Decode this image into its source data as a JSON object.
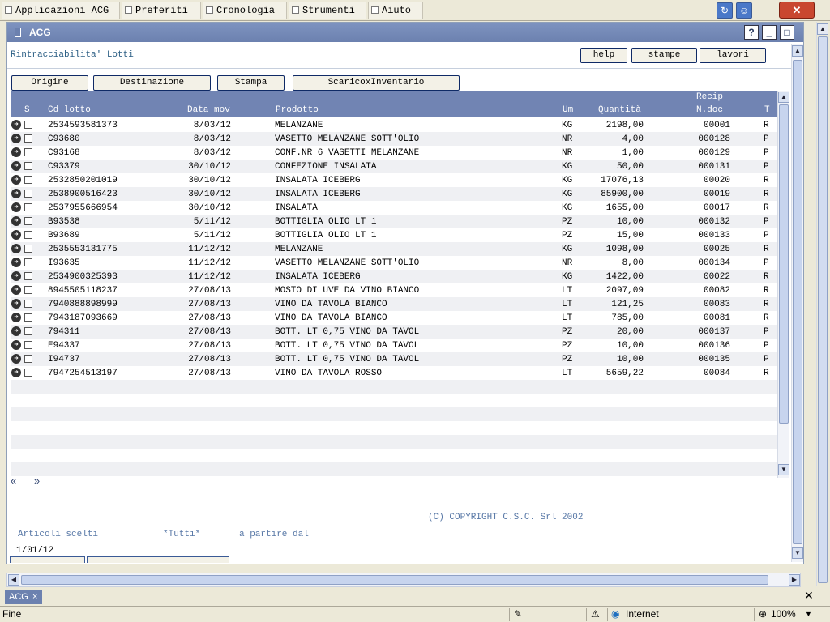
{
  "menubar": {
    "items": [
      "Applicazioni ACG",
      "Preferiti",
      "Cronologia",
      "Strumenti",
      "Aiuto"
    ],
    "close_icon": "close-icon"
  },
  "window": {
    "title": "ACG",
    "help_btn": "?",
    "min_btn": "_",
    "max_btn": "□"
  },
  "page": {
    "subtitle": "Rintracciabilita' Lotti",
    "top_buttons": [
      "help",
      "stampe",
      "lavori"
    ],
    "nav_buttons": [
      "Origine",
      "Destinazione",
      "Stampa",
      "ScaricoxInventario"
    ]
  },
  "table": {
    "headers": {
      "s": "S",
      "cd_lotto": "Cd lotto",
      "data_mov": "Data mov",
      "prodotto": "Prodotto",
      "um": "Um",
      "quantita": "Quantità",
      "recip": "Recip",
      "ndoc": "N.doc",
      "t": "T"
    },
    "rows": [
      [
        "2534593581373",
        "8/03/12",
        "MELANZANE",
        "KG",
        "2198,00",
        "00001",
        "R"
      ],
      [
        "C93680",
        "8/03/12",
        "VASETTO MELANZANE SOTT'OLIO",
        "NR",
        "4,00",
        "000128",
        "P"
      ],
      [
        "C93168",
        "8/03/12",
        "CONF.NR 6 VASETTI MELANZANE",
        "NR",
        "1,00",
        "000129",
        "P"
      ],
      [
        "C93379",
        "30/10/12",
        "CONFEZIONE INSALATA",
        "KG",
        "50,00",
        "000131",
        "P"
      ],
      [
        "2532850201019",
        "30/10/12",
        "INSALATA ICEBERG",
        "KG",
        "17076,13",
        "00020",
        "R"
      ],
      [
        "2538900516423",
        "30/10/12",
        "INSALATA ICEBERG",
        "KG",
        "85900,00",
        "00019",
        "R"
      ],
      [
        "2537955666954",
        "30/10/12",
        "INSALATA",
        "KG",
        "1655,00",
        "00017",
        "R"
      ],
      [
        "B93538",
        "5/11/12",
        "BOTTIGLIA OLIO LT 1",
        "PZ",
        "10,00",
        "000132",
        "P"
      ],
      [
        "B93689",
        "5/11/12",
        "BOTTIGLIA OLIO LT 1",
        "PZ",
        "15,00",
        "000133",
        "P"
      ],
      [
        "2535553131775",
        "11/12/12",
        "MELANZANE",
        "KG",
        "1098,00",
        "00025",
        "R"
      ],
      [
        "I93635",
        "11/12/12",
        "VASETTO MELANZANE SOTT'OLIO",
        "NR",
        "8,00",
        "000134",
        "P"
      ],
      [
        "2534900325393",
        "11/12/12",
        "INSALATA ICEBERG",
        "KG",
        "1422,00",
        "00022",
        "R"
      ],
      [
        "8945505118237",
        "27/08/13",
        "MOSTO DI UVE DA VINO BIANCO",
        "LT",
        "2097,09",
        "00082",
        "R"
      ],
      [
        "7940888898999",
        "27/08/13",
        "VINO DA TAVOLA BIANCO",
        "LT",
        "121,25",
        "00083",
        "R"
      ],
      [
        "7943187093669",
        "27/08/13",
        "VINO DA TAVOLA BIANCO",
        "LT",
        "785,00",
        "00081",
        "R"
      ],
      [
        "794311",
        "27/08/13",
        "BOTT. LT 0,75 VINO DA TAVOL",
        "PZ",
        "20,00",
        "000137",
        "P"
      ],
      [
        "E94337",
        "27/08/13",
        "BOTT. LT 0,75 VINO DA TAVOL",
        "PZ",
        "10,00",
        "000136",
        "P"
      ],
      [
        "I94737",
        "27/08/13",
        "BOTT. LT 0,75 VINO DA TAVOL",
        "PZ",
        "10,00",
        "000135",
        "P"
      ],
      [
        "7947254513197",
        "27/08/13",
        "VINO DA TAVOLA ROSSO",
        "LT",
        "5659,22",
        "00084",
        "R"
      ]
    ]
  },
  "pager": {
    "prev": "«",
    "next": "»"
  },
  "footer": {
    "copyright": "(C) COPYRIGHT C.S.C. Srl 2002",
    "articoli_label": "Articoli scelti",
    "articoli_value": "*Tutti*",
    "partire_label": "a partire dal",
    "date": "1/01/12"
  },
  "tabs": {
    "active": "ACG",
    "close": "×"
  },
  "statusbar": {
    "text": "Fine",
    "zone": "Internet",
    "zoom": "100%"
  }
}
